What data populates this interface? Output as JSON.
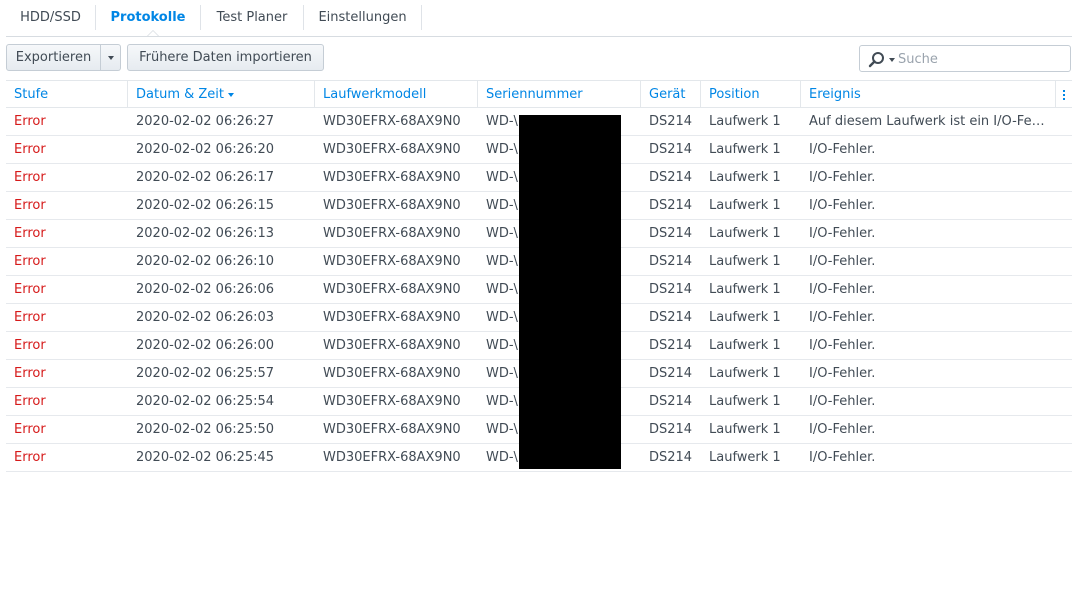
{
  "tabs": [
    {
      "label": "HDD/SSD",
      "active": false
    },
    {
      "label": "Protokolle",
      "active": true
    },
    {
      "label": "Test Planer",
      "active": false
    },
    {
      "label": "Einstellungen",
      "active": false
    }
  ],
  "toolbar": {
    "export_label": "Exportieren",
    "import_label": "Frühere Daten importieren",
    "search_placeholder": "Suche",
    "search_value": ""
  },
  "columns": {
    "level": "Stufe",
    "datetime": "Datum & Zeit",
    "model": "Laufwerkmodell",
    "serial": "Seriennummer",
    "device": "Gerät",
    "position": "Position",
    "event": "Ereignis"
  },
  "rows": [
    {
      "level": "Error",
      "datetime": "2020-02-02 06:26:27",
      "model": "WD30EFRX-68AX9N0",
      "serial": "WD-\\",
      "device": "DS214",
      "position": "Laufwerk 1",
      "event": "Auf diesem Laufwerk ist ein I/O-Feh…"
    },
    {
      "level": "Error",
      "datetime": "2020-02-02 06:26:20",
      "model": "WD30EFRX-68AX9N0",
      "serial": "WD-\\",
      "device": "DS214",
      "position": "Laufwerk 1",
      "event": "I/O-Fehler."
    },
    {
      "level": "Error",
      "datetime": "2020-02-02 06:26:17",
      "model": "WD30EFRX-68AX9N0",
      "serial": "WD-\\",
      "device": "DS214",
      "position": "Laufwerk 1",
      "event": "I/O-Fehler."
    },
    {
      "level": "Error",
      "datetime": "2020-02-02 06:26:15",
      "model": "WD30EFRX-68AX9N0",
      "serial": "WD-\\",
      "device": "DS214",
      "position": "Laufwerk 1",
      "event": "I/O-Fehler."
    },
    {
      "level": "Error",
      "datetime": "2020-02-02 06:26:13",
      "model": "WD30EFRX-68AX9N0",
      "serial": "WD-\\",
      "device": "DS214",
      "position": "Laufwerk 1",
      "event": "I/O-Fehler."
    },
    {
      "level": "Error",
      "datetime": "2020-02-02 06:26:10",
      "model": "WD30EFRX-68AX9N0",
      "serial": "WD-\\",
      "device": "DS214",
      "position": "Laufwerk 1",
      "event": "I/O-Fehler."
    },
    {
      "level": "Error",
      "datetime": "2020-02-02 06:26:06",
      "model": "WD30EFRX-68AX9N0",
      "serial": "WD-\\",
      "device": "DS214",
      "position": "Laufwerk 1",
      "event": "I/O-Fehler."
    },
    {
      "level": "Error",
      "datetime": "2020-02-02 06:26:03",
      "model": "WD30EFRX-68AX9N0",
      "serial": "WD-\\",
      "device": "DS214",
      "position": "Laufwerk 1",
      "event": "I/O-Fehler."
    },
    {
      "level": "Error",
      "datetime": "2020-02-02 06:26:00",
      "model": "WD30EFRX-68AX9N0",
      "serial": "WD-\\",
      "device": "DS214",
      "position": "Laufwerk 1",
      "event": "I/O-Fehler."
    },
    {
      "level": "Error",
      "datetime": "2020-02-02 06:25:57",
      "model": "WD30EFRX-68AX9N0",
      "serial": "WD-\\",
      "device": "DS214",
      "position": "Laufwerk 1",
      "event": "I/O-Fehler."
    },
    {
      "level": "Error",
      "datetime": "2020-02-02 06:25:54",
      "model": "WD30EFRX-68AX9N0",
      "serial": "WD-\\",
      "device": "DS214",
      "position": "Laufwerk 1",
      "event": "I/O-Fehler."
    },
    {
      "level": "Error",
      "datetime": "2020-02-02 06:25:50",
      "model": "WD30EFRX-68AX9N0",
      "serial": "WD-\\",
      "device": "DS214",
      "position": "Laufwerk 1",
      "event": "I/O-Fehler."
    },
    {
      "level": "Error",
      "datetime": "2020-02-02 06:25:45",
      "model": "WD30EFRX-68AX9N0",
      "serial": "WD-\\",
      "device": "DS214",
      "position": "Laufwerk 1",
      "event": "I/O-Fehler."
    }
  ],
  "colors": {
    "accent": "#0086e5",
    "error": "#d61a1a",
    "redaction": "#000000"
  },
  "icons": {
    "search": "search-icon",
    "column_menu": "column-menu-icon",
    "dropdown": "chevron-down-icon"
  }
}
